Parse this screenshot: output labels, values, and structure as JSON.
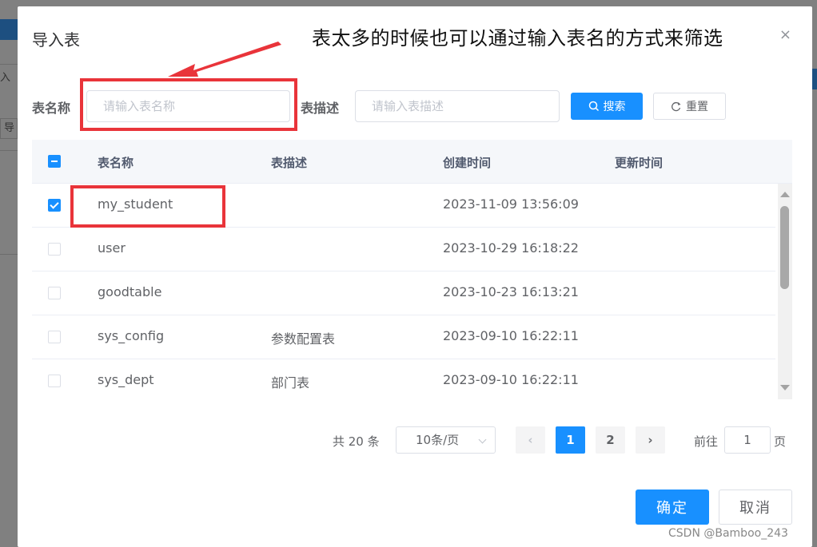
{
  "background": {
    "side_text": "入",
    "box_text": "导"
  },
  "dialog": {
    "title": "导入表",
    "annotation": "表太多的时候也可以通过输入表名的方式来筛选",
    "close_glyph": "×"
  },
  "search": {
    "table_name_label": "表名称",
    "table_name_placeholder": "请输入表名称",
    "table_desc_label": "表描述",
    "table_desc_placeholder": "请输入表描述",
    "search_label": "搜索",
    "reset_label": "重置"
  },
  "table": {
    "headers": [
      "表名称",
      "表描述",
      "创建时间",
      "更新时间"
    ],
    "rows": [
      {
        "name": "my_student",
        "desc": "",
        "created": "2023-11-09 13:56:09",
        "updated": "",
        "checked": true
      },
      {
        "name": "user",
        "desc": "",
        "created": "2023-10-29 16:18:22",
        "updated": "",
        "checked": false
      },
      {
        "name": "goodtable",
        "desc": "",
        "created": "2023-10-23 16:13:21",
        "updated": "",
        "checked": false
      },
      {
        "name": "sys_config",
        "desc": "参数配置表",
        "created": "2023-09-10 16:22:11",
        "updated": "",
        "checked": false
      },
      {
        "name": "sys_dept",
        "desc": "部门表",
        "created": "2023-09-10 16:22:11",
        "updated": "",
        "checked": false
      }
    ]
  },
  "pagination": {
    "total_text": "共 20 条",
    "page_size": "10条/页",
    "prev_glyph": "‹",
    "next_glyph": "›",
    "pages": [
      "1",
      "2"
    ],
    "current_page": "1",
    "goto_label": "前往",
    "goto_value": "1",
    "page_suffix": "页"
  },
  "footer": {
    "confirm_label": "确定",
    "cancel_label": "取消",
    "watermark": "CSDN @Bamboo_243"
  },
  "colors": {
    "primary": "#1890ff",
    "annotation_red": "#e9343a"
  },
  "icons": {
    "search": "search-icon",
    "reset": "refresh-icon",
    "close": "close-icon"
  }
}
